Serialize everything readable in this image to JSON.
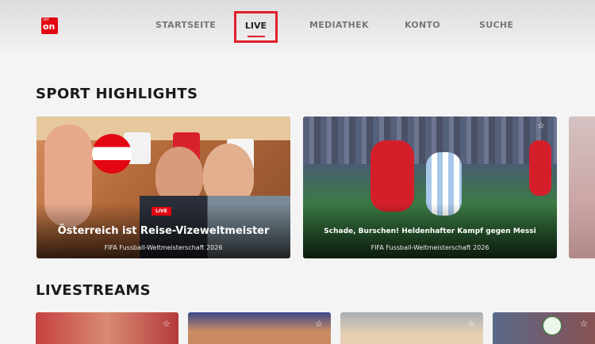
{
  "brand": {
    "small": "ORF",
    "big": "on"
  },
  "nav": {
    "startseite": "STARTSEITE",
    "live": "LIVE",
    "mediathek": "MEDIATHEK",
    "konto": "KONTO",
    "suche": "SUCHE"
  },
  "sections": {
    "highlights": "SPORT HIGHLIGHTS",
    "livestreams": "LIVESTREAMS"
  },
  "highlights": [
    {
      "badge": "LIVE",
      "title": "Österreich ist Reise-Vizeweltmeister",
      "subtitle": "FIFA Fussball-Weltmeisterschaft 2026"
    },
    {
      "title": "Schade, Burschen! Heldenhafter Kampf gegen Messi",
      "subtitle": "FIFA Fussball-Weltmeisterschaft 2026"
    }
  ],
  "icons": {
    "favorite": "star-icon"
  },
  "colors": {
    "accent": "#e0202c",
    "brand": "#e30613"
  }
}
